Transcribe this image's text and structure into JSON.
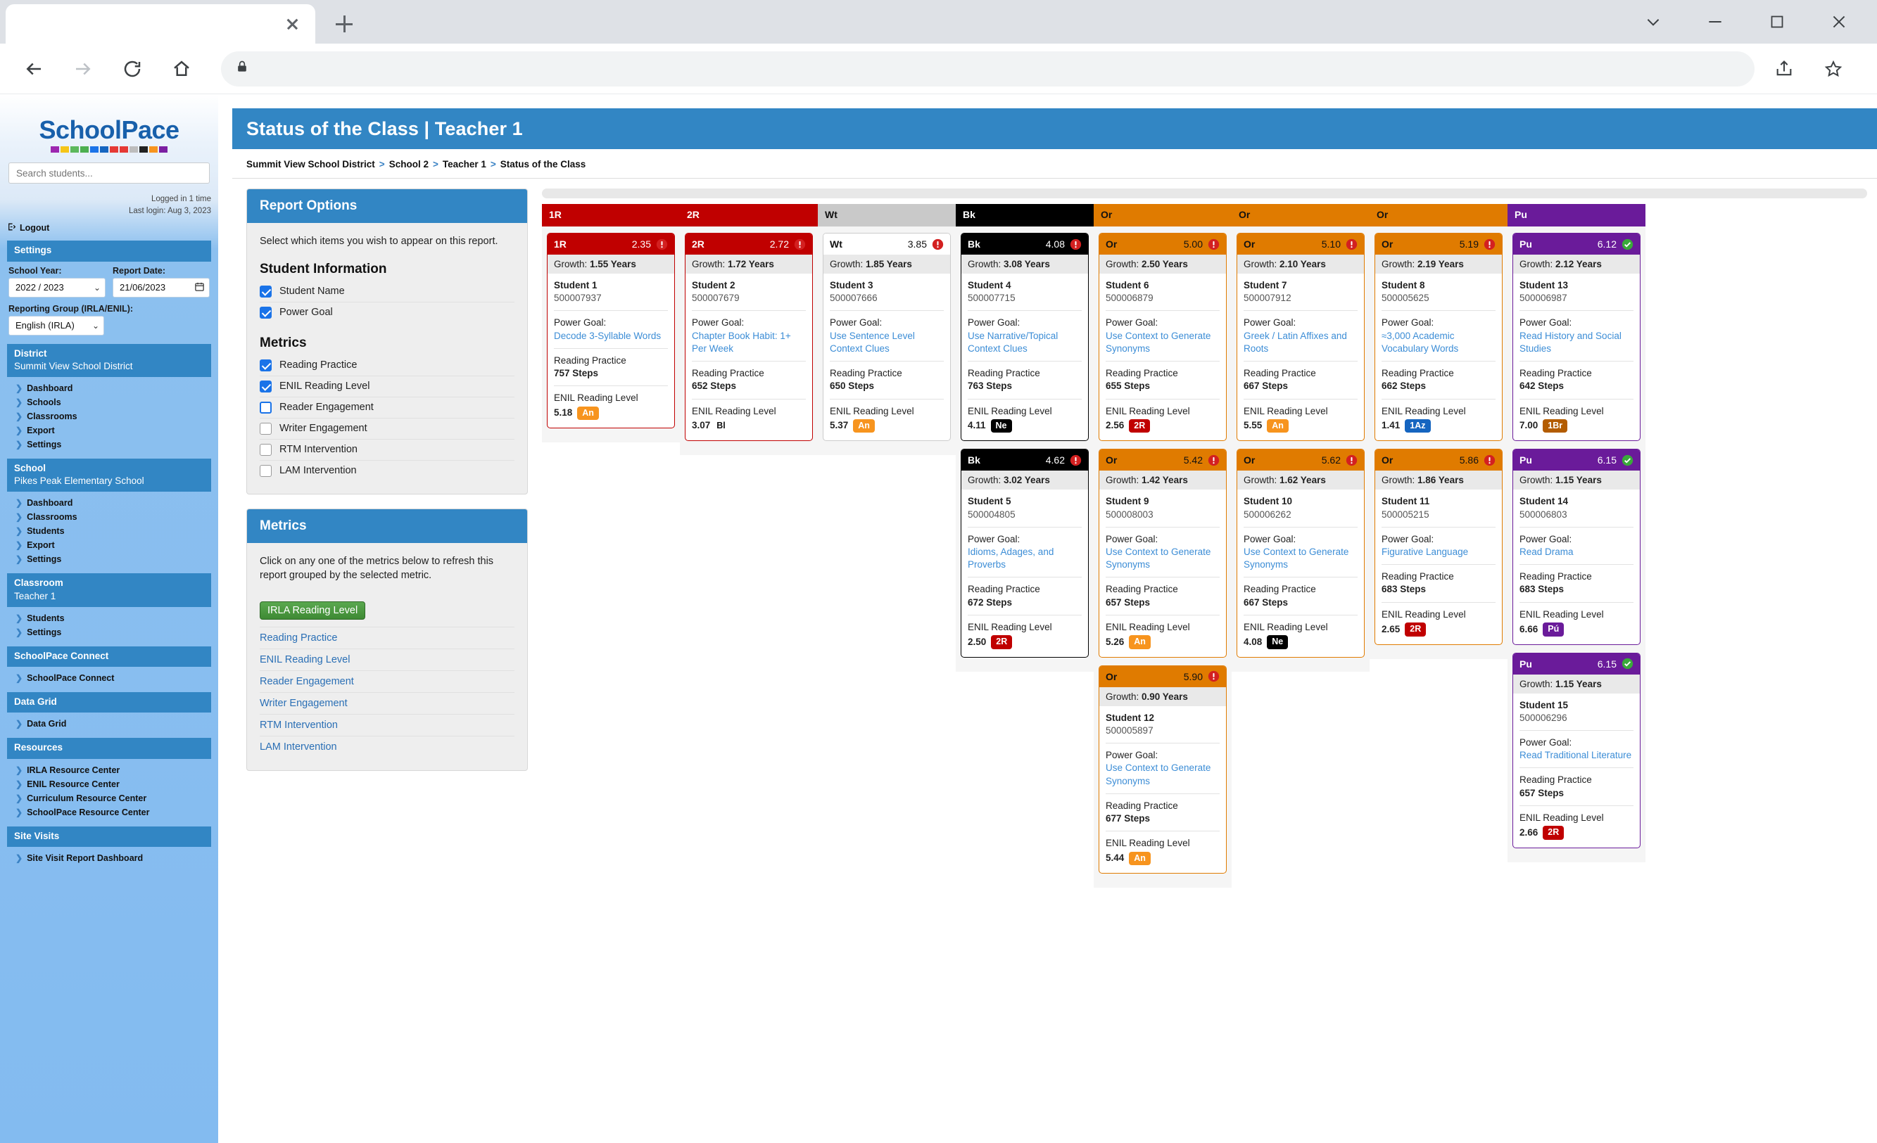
{
  "browser": {
    "tab_title": "",
    "address": "",
    "icons": {
      "back": "back-arrow-icon",
      "forward": "forward-arrow-icon",
      "reload": "reload-icon",
      "home": "home-icon",
      "lock": "lock-icon",
      "share": "share-icon",
      "bookmark": "star-icon"
    }
  },
  "sidebar": {
    "logo_text": "SchoolPace",
    "logo_colors": [
      "#9c27b0",
      "#f5c518",
      "#5cb85c",
      "#4caf50",
      "#1a73e8",
      "#1565c0",
      "#e53935",
      "#e53935",
      "#bdbdbd",
      "#212121",
      "#f7941e",
      "#7b1fa2"
    ],
    "search_placeholder": "Search students...",
    "login_count": "Logged in 1 time",
    "last_login": "Last login: Aug 3, 2023",
    "logout_label": "Logout",
    "settings": {
      "header": "Settings",
      "school_year_label": "School Year:",
      "school_year_value": "2022 / 2023",
      "report_date_label": "Report Date:",
      "report_date_value": "21/06/2023",
      "reporting_group_label": "Reporting Group (IRLA/ENIL):",
      "reporting_group_value": "English (IRLA)"
    },
    "sections": [
      {
        "title": "District",
        "subtitle": "Summit View School District",
        "items": [
          "Dashboard",
          "Schools",
          "Classrooms",
          "Export",
          "Settings"
        ]
      },
      {
        "title": "School",
        "subtitle": "Pikes Peak Elementary School",
        "items": [
          "Dashboard",
          "Classrooms",
          "Students",
          "Export",
          "Settings"
        ]
      },
      {
        "title": "Classroom",
        "subtitle": "Teacher 1",
        "items": [
          "Students",
          "Settings"
        ]
      },
      {
        "title": "SchoolPace Connect",
        "subtitle": "",
        "items": [
          "SchoolPace Connect"
        ]
      },
      {
        "title": "Data Grid",
        "subtitle": "",
        "items": [
          "Data Grid"
        ]
      },
      {
        "title": "Resources",
        "subtitle": "",
        "items": [
          "IRLA Resource Center",
          "ENIL Resource Center",
          "Curriculum Resource Center",
          "SchoolPace Resource Center"
        ]
      },
      {
        "title": "Site Visits",
        "subtitle": "",
        "items": [
          "Site Visit Report Dashboard"
        ]
      }
    ]
  },
  "main": {
    "page_title": "Status of the Class | Teacher 1",
    "breadcrumb": [
      "Summit View School District",
      "School 2",
      "Teacher 1",
      "Status of the Class"
    ],
    "report_options": {
      "header": "Report Options",
      "intro": "Select which items you wish to appear on this report.",
      "group1_title": "Student Information",
      "group1": [
        {
          "label": "Student Name",
          "checked": true
        },
        {
          "label": "Power Goal",
          "checked": true
        }
      ],
      "group2_title": "Metrics",
      "group2": [
        {
          "label": "Reading Practice",
          "checked": true
        },
        {
          "label": "ENIL Reading Level",
          "checked": true
        },
        {
          "label": "Reader Engagement",
          "checked": false,
          "focused": true
        },
        {
          "label": "Writer Engagement",
          "checked": false
        },
        {
          "label": "RTM Intervention",
          "checked": false
        },
        {
          "label": "LAM Intervention",
          "checked": false
        }
      ]
    },
    "metrics_panel": {
      "header": "Metrics",
      "intro": "Click on any one of the metrics below to refresh this report grouped by the selected metric.",
      "active": "IRLA Reading Level",
      "links": [
        "Reading Practice",
        "ENIL Reading Level",
        "Reader Engagement",
        "Writer Engagement",
        "RTM Intervention",
        "LAM Intervention"
      ]
    },
    "labels": {
      "growth_prefix": "Growth: ",
      "power_goal": "Power Goal:",
      "reading_practice": "Reading Practice",
      "enil_reading_level": "ENIL Reading Level"
    }
  },
  "board": {
    "columns": [
      {
        "name": "1R",
        "header_bg": "#c00000",
        "header_fg": "#ffffff",
        "cards": [
          {
            "level": "1R",
            "value": "2.35",
            "status": "alert",
            "growth": "1.55 Years",
            "student": "Student 1",
            "sid": "500007937",
            "goal": "Decode 3-Syllable Words",
            "steps": "757 Steps",
            "enil": "5.18",
            "badge": "An",
            "badge_bg": "#f7941e",
            "badge_fg": "#ffffff"
          }
        ]
      },
      {
        "name": "2R",
        "header_bg": "#c00000",
        "header_fg": "#ffffff",
        "cards": [
          {
            "level": "2R",
            "value": "2.72",
            "status": "alert",
            "growth": "1.72 Years",
            "student": "Student 2",
            "sid": "500007679",
            "goal": "Chapter Book Habit: 1+ Per Week",
            "steps": "652 Steps",
            "enil": "3.07",
            "badge": "Bl",
            "badge_bg": "transparent",
            "badge_fg": "#111111"
          }
        ]
      },
      {
        "name": "Wt",
        "header_bg": "#c9c9c9",
        "header_fg": "#111111",
        "cards": [
          {
            "level": "Wt",
            "value": "3.85",
            "status": "alert",
            "growth": "1.85 Years",
            "student": "Student 3",
            "sid": "500007666",
            "goal": "Use Sentence Level Context Clues",
            "steps": "650 Steps",
            "enil": "5.37",
            "badge": "An",
            "badge_bg": "#f7941e",
            "badge_fg": "#ffffff",
            "card_hd_bg": "#ffffff",
            "card_hd_fg": "#111111",
            "border": "#cccccc"
          }
        ]
      },
      {
        "name": "Bk",
        "header_bg": "#000000",
        "header_fg": "#ffffff",
        "cards": [
          {
            "level": "Bk",
            "value": "4.08",
            "status": "alert",
            "growth": "3.08 Years",
            "student": "Student 4",
            "sid": "500007715",
            "goal": "Use Narrative/Topical Context Clues",
            "steps": "763 Steps",
            "enil": "4.11",
            "badge": "Ne",
            "badge_bg": "#000000",
            "badge_fg": "#ffffff"
          },
          {
            "level": "Bk",
            "value": "4.62",
            "status": "alert",
            "growth": "3.02 Years",
            "student": "Student 5",
            "sid": "500004805",
            "goal": "Idioms, Adages, and Proverbs",
            "steps": "672 Steps",
            "enil": "2.50",
            "badge": "2R",
            "badge_bg": "#c00000",
            "badge_fg": "#ffffff"
          }
        ]
      },
      {
        "name": "Or",
        "header_bg": "#e07b00",
        "header_fg": "#111111",
        "cards": [
          {
            "level": "Or",
            "value": "5.00",
            "status": "alert",
            "growth": "2.50 Years",
            "student": "Student 6",
            "sid": "500006879",
            "goal": "Use Context to Generate Synonyms",
            "steps": "655 Steps",
            "enil": "2.56",
            "badge": "2R",
            "badge_bg": "#c00000",
            "badge_fg": "#ffffff"
          },
          {
            "level": "Or",
            "value": "5.42",
            "status": "alert",
            "growth": "1.42 Years",
            "student": "Student 9",
            "sid": "500008003",
            "goal": "Use Context to Generate Synonyms",
            "steps": "657 Steps",
            "enil": "5.26",
            "badge": "An",
            "badge_bg": "#f7941e",
            "badge_fg": "#ffffff"
          },
          {
            "level": "Or",
            "value": "5.90",
            "status": "alert",
            "growth": "0.90 Years",
            "student": "Student 12",
            "sid": "500005897",
            "goal": "Use Context to Generate Synonyms",
            "steps": "677 Steps",
            "enil": "5.44",
            "badge": "An",
            "badge_bg": "#f7941e",
            "badge_fg": "#ffffff"
          }
        ]
      },
      {
        "name": "Or",
        "header_bg": "#e07b00",
        "header_fg": "#111111",
        "cards": [
          {
            "level": "Or",
            "value": "5.10",
            "status": "alert",
            "growth": "2.10 Years",
            "student": "Student 7",
            "sid": "500007912",
            "goal": "Greek / Latin Affixes and Roots",
            "steps": "667 Steps",
            "enil": "5.55",
            "badge": "An",
            "badge_bg": "#f7941e",
            "badge_fg": "#ffffff"
          },
          {
            "level": "Or",
            "value": "5.62",
            "status": "alert",
            "growth": "1.62 Years",
            "student": "Student 10",
            "sid": "500006262",
            "goal": "Use Context to Generate Synonyms",
            "steps": "667 Steps",
            "enil": "4.08",
            "badge": "Ne",
            "badge_bg": "#000000",
            "badge_fg": "#ffffff"
          }
        ]
      },
      {
        "name": "Or",
        "header_bg": "#e07b00",
        "header_fg": "#111111",
        "cards": [
          {
            "level": "Or",
            "value": "5.19",
            "status": "alert",
            "growth": "2.19 Years",
            "student": "Student 8",
            "sid": "500005625",
            "goal": "≈3,000 Academic Vocabulary Words",
            "steps": "662 Steps",
            "enil": "1.41",
            "badge": "1Az",
            "badge_bg": "#1565c0",
            "badge_fg": "#ffffff"
          },
          {
            "level": "Or",
            "value": "5.86",
            "status": "alert",
            "growth": "1.86 Years",
            "student": "Student 11",
            "sid": "500005215",
            "goal": "Figurative Language",
            "steps": "683 Steps",
            "enil": "2.65",
            "badge": "2R",
            "badge_bg": "#c00000",
            "badge_fg": "#ffffff"
          }
        ]
      },
      {
        "name": "Pu",
        "header_bg": "#6a1b9a",
        "header_fg": "#ffffff",
        "cards": [
          {
            "level": "Pu",
            "value": "6.12",
            "status": "ok",
            "growth": "2.12 Years",
            "student": "Student 13",
            "sid": "500006987",
            "goal": "Read History and Social Studies",
            "steps": "642 Steps",
            "enil": "7.00",
            "badge": "1Br",
            "badge_bg": "#b35c00",
            "badge_fg": "#ffffff"
          },
          {
            "level": "Pu",
            "value": "6.15",
            "status": "ok",
            "growth": "1.15 Years",
            "student": "Student 14",
            "sid": "500006803",
            "goal": "Read Drama",
            "steps": "683 Steps",
            "enil": "6.66",
            "badge": "Pú",
            "badge_bg": "#6a1b9a",
            "badge_fg": "#ffffff"
          },
          {
            "level": "Pu",
            "value": "6.15",
            "status": "ok",
            "growth": "1.15 Years",
            "student": "Student 15",
            "sid": "500006296",
            "goal": "Read Traditional Literature",
            "steps": "657 Steps",
            "enil": "2.66",
            "badge": "2R",
            "badge_bg": "#c00000",
            "badge_fg": "#ffffff"
          }
        ]
      }
    ]
  }
}
